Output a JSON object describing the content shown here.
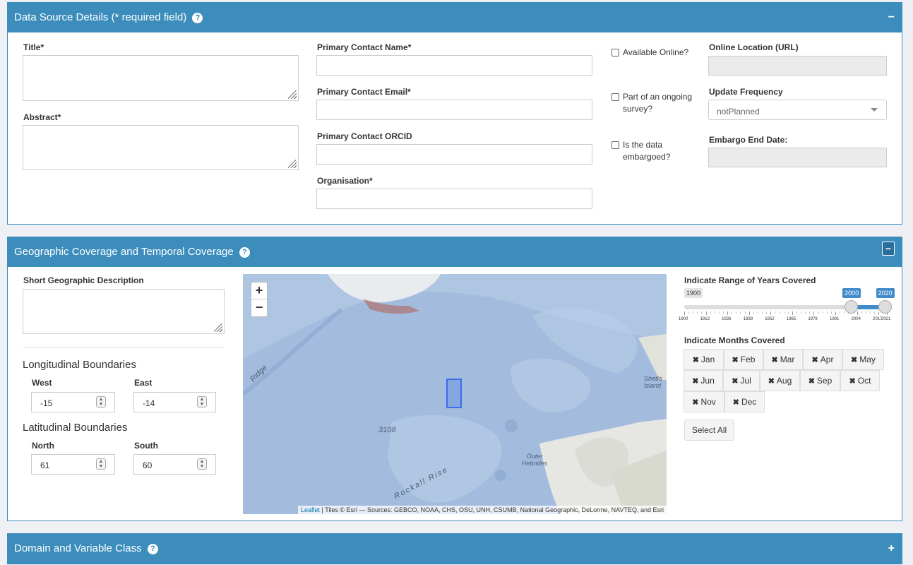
{
  "data_source_panel": {
    "title": "Data Source Details (* required field)",
    "help_glyph": "?",
    "toggle": "−",
    "title_label": "Title*",
    "abstract_label": "Abstract*",
    "contact_name_label": "Primary Contact Name*",
    "contact_email_label": "Primary Contact Email*",
    "contact_orcid_label": "Primary Contact ORCID",
    "organisation_label": "Organisation*",
    "available_online_label": "Available Online?",
    "ongoing_survey_label": "Part of an ongoing survey?",
    "embargoed_label": "Is the data embargoed?",
    "online_location_label": "Online Location (URL)",
    "update_frequency_label": "Update Frequency",
    "update_frequency_value": "notPlanned",
    "embargo_end_label": "Embargo End Date:"
  },
  "geo_panel": {
    "title": "Geographic Coverage and Temporal Coverage",
    "help_glyph": "?",
    "toggle": "−",
    "short_geo_label": "Short Geographic Description",
    "longitudinal_title": "Longitudinal Boundaries",
    "west_label": "West",
    "west_value": "-15",
    "east_label": "East",
    "east_value": "-14",
    "latitudinal_title": "Latitudinal Boundaries",
    "north_label": "North",
    "north_value": "61",
    "south_label": "South",
    "south_value": "60",
    "map": {
      "zoom_in": "+",
      "zoom_out": "−",
      "attribution_link": "Leaflet",
      "attribution_text": " | Tiles © Esri — Sources: GEBCO, NOAA, CHS, OSU, UNH, CSUMB, National Geographic, DeLorme, NAVTEQ, and Esri",
      "labels": {
        "ridge": "Ridge",
        "depth": "3108",
        "rockall": "Rockall Rise",
        "outer_hebrides": "Outer\nHebrides",
        "shetland": "Shetla\nIsland"
      }
    },
    "years_title": "Indicate Range of Years Covered",
    "year_min_badge": "1900",
    "year_from": "2000",
    "year_to": "2020",
    "year_range_fraction": [
      0.8264,
      0.9917
    ],
    "year_ticks": [
      "1900",
      "1913",
      "1926",
      "1939",
      "1952",
      "1965",
      "1978",
      "1991",
      "2004",
      "2017",
      "2021"
    ],
    "months_title": "Indicate Months Covered",
    "months": [
      "Jan",
      "Feb",
      "Mar",
      "Apr",
      "May",
      "Jun",
      "Jul",
      "Aug",
      "Sep",
      "Oct",
      "Nov",
      "Dec"
    ],
    "month_glyph": "✖",
    "select_all": "Select All"
  },
  "domain_panel": {
    "title": "Domain and Variable Class",
    "help_glyph": "?",
    "toggle": "+"
  }
}
